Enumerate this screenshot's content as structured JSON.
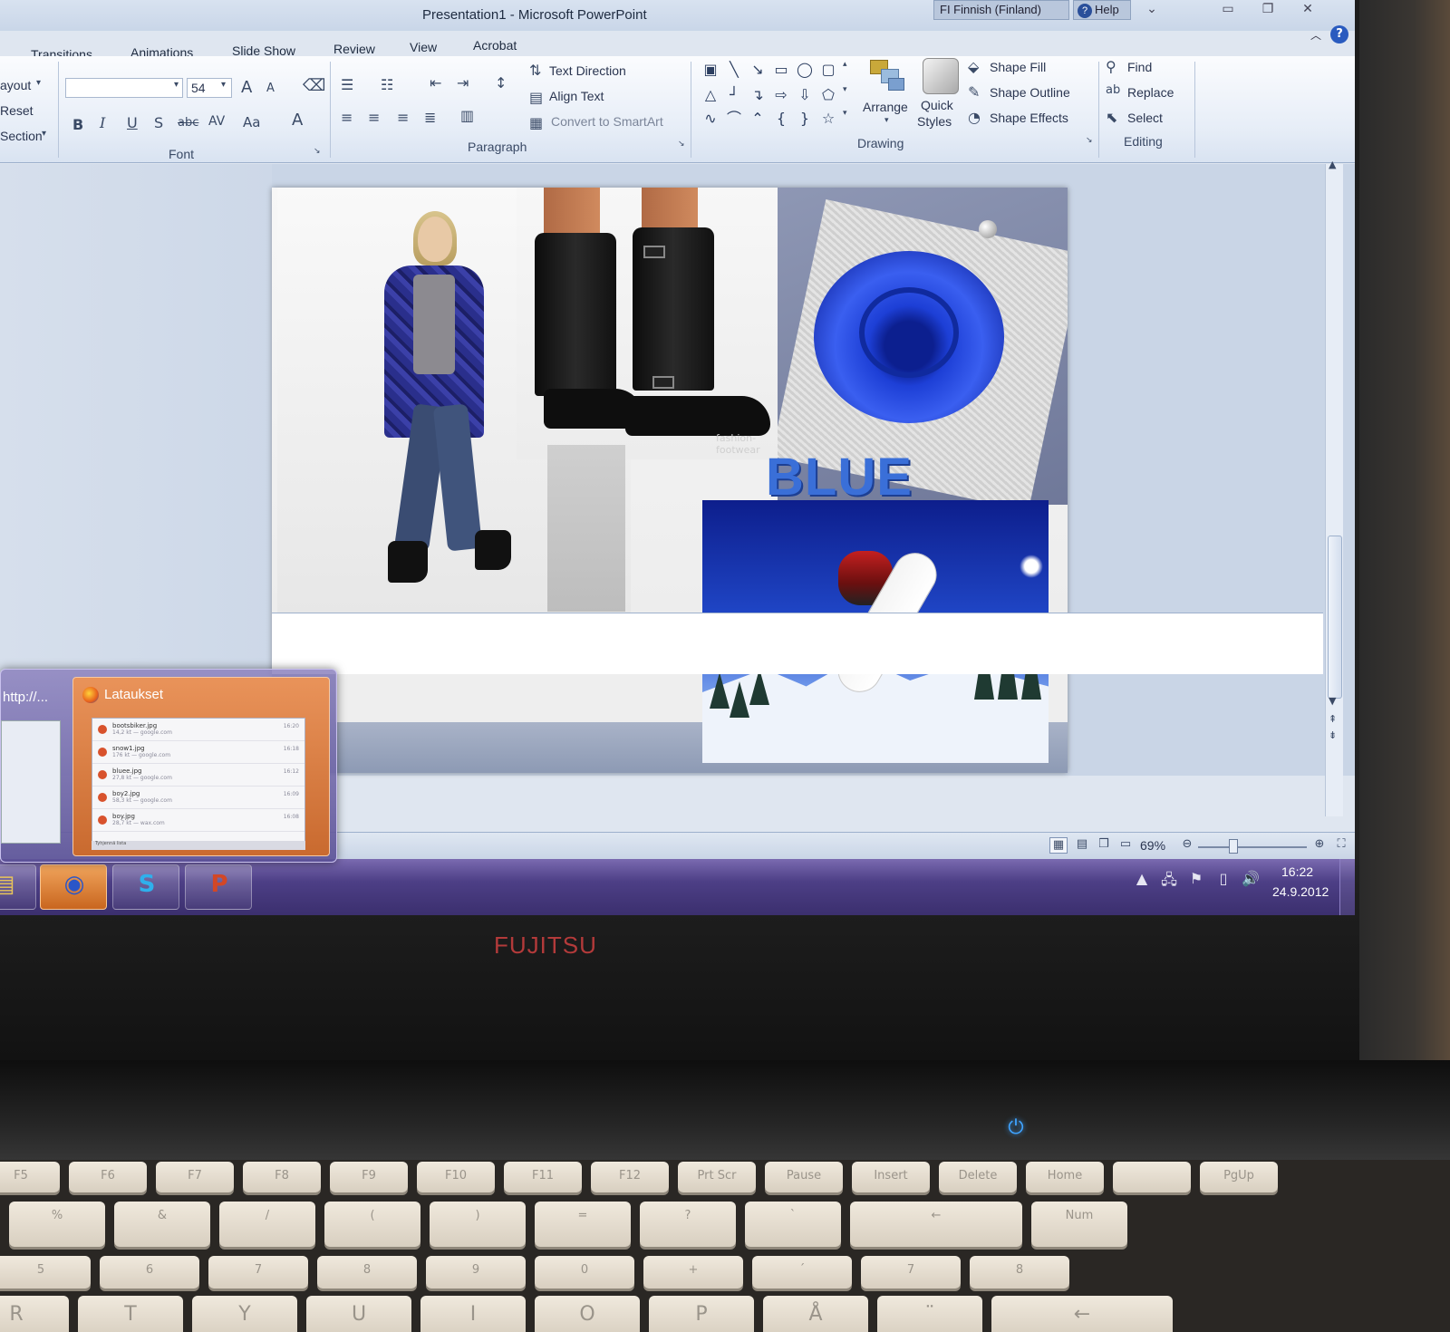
{
  "window": {
    "title": "Presentation1 - Microsoft PowerPoint",
    "language": "FI  Finnish (Finland)",
    "help": "Help"
  },
  "tabs": [
    "Transitions",
    "Animations",
    "Slide Show",
    "Review",
    "View",
    "Acrobat"
  ],
  "slides_group": {
    "layout": "ayout",
    "reset": "Reset",
    "section": "Section"
  },
  "font_group": {
    "label": "Font",
    "font_name": "",
    "font_size": "54",
    "bold": "B",
    "italic": "I",
    "underline": "U",
    "shadow": "S",
    "strike": "abc",
    "spacing": "AV",
    "change_case": "Aa",
    "font_color": "A",
    "grow": "A",
    "shrink": "A"
  },
  "paragraph_group": {
    "label": "Paragraph",
    "text_direction": "Text Direction",
    "align_text": "Align Text",
    "convert_smartart": "Convert to SmartArt"
  },
  "drawing_group": {
    "label": "Drawing",
    "arrange": "Arrange",
    "quick_styles_1": "Quick",
    "quick_styles_2": "Styles",
    "shape_fill": "Shape Fill",
    "shape_outline": "Shape Outline",
    "shape_effects": "Shape Effects"
  },
  "editing_group": {
    "label": "Editing",
    "find": "Find",
    "replace": "Replace",
    "select": "Select"
  },
  "slide": {
    "headline": "BLUE",
    "boots_watermark": "fashion-footwear",
    "colors": {
      "headline": "#3a6fd8",
      "rose": "#1d3fd6"
    }
  },
  "status": {
    "zoom": "69%"
  },
  "taskbar": {
    "time": "16:22",
    "date": "24.9.2012",
    "buttons": [
      {
        "name": "explorer",
        "glyph": "▤"
      },
      {
        "name": "firefox",
        "glyph": "◉"
      },
      {
        "name": "skype",
        "glyph": "S"
      },
      {
        "name": "powerpoint",
        "glyph": "P"
      }
    ]
  },
  "thumb_popup": {
    "left_title": "http://...",
    "right_title": "Lataukset",
    "downloads": [
      {
        "name": "bootsbiker.jpg",
        "meta": "14,2 kt — google.com",
        "time": "16:20"
      },
      {
        "name": "snow1.jpg",
        "meta": "176 kt — google.com",
        "time": "16:18"
      },
      {
        "name": "bluee.jpg",
        "meta": "27,8 kt — google.com",
        "time": "16:12"
      },
      {
        "name": "boy2.jpg",
        "meta": "58,3 kt — google.com",
        "time": "16:09"
      },
      {
        "name": "boy.jpg",
        "meta": "28,7 kt — wax.com",
        "time": "16:08"
      }
    ],
    "footer": "Tyhjennä lista"
  },
  "laptop": {
    "brand": "FUJITSU"
  },
  "keyboard": {
    "row1": [
      "F5",
      "F6",
      "F7",
      "F8",
      "F9",
      "F10",
      "F11",
      "F12",
      "Prt Scr",
      "Pause",
      "Insert",
      "Delete",
      "Home",
      "",
      "PgUp"
    ],
    "row2": [
      "%",
      "&",
      "/",
      "(",
      ")",
      "=",
      "?",
      "`",
      "←",
      "Num"
    ],
    "row3": [
      "5",
      "6",
      "7",
      "8",
      "9",
      "0",
      "+",
      "´",
      "7",
      "8"
    ],
    "row4": [
      "R",
      "T",
      "Y",
      "U",
      "I",
      "O",
      "P",
      "Å",
      "¨",
      "←"
    ]
  }
}
